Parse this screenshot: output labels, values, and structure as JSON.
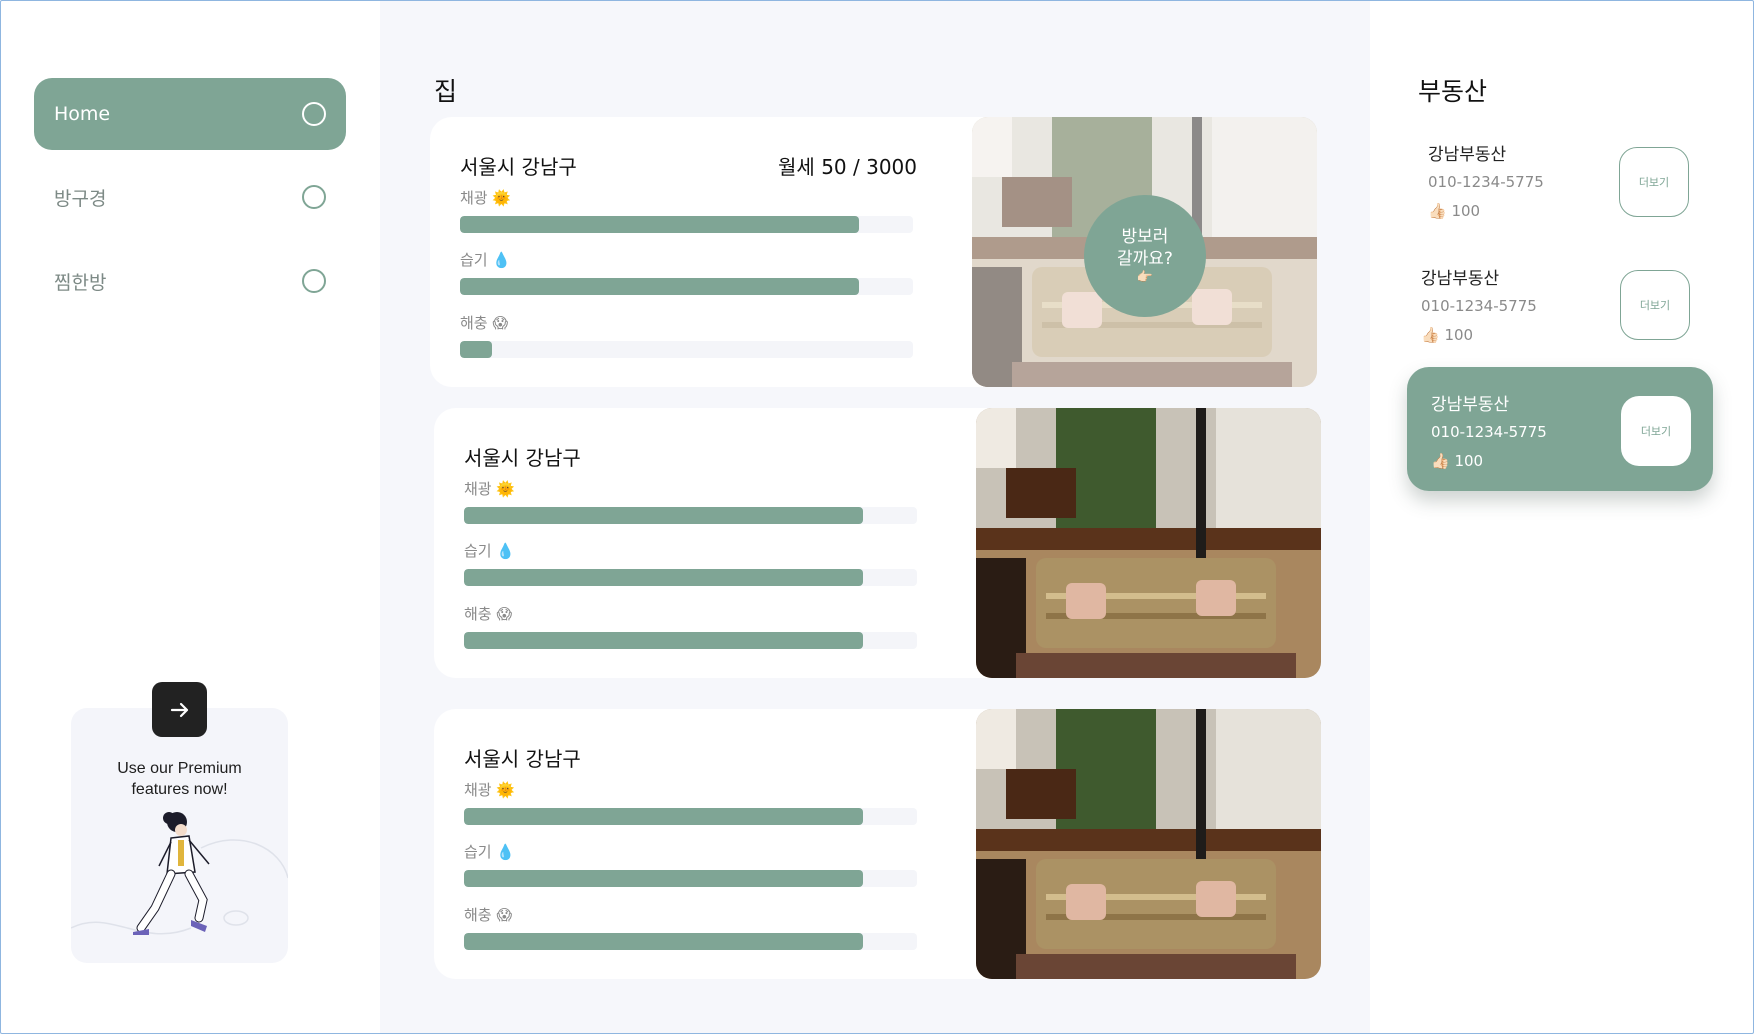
{
  "sidebar": {
    "items": [
      {
        "label": "Home",
        "active": true
      },
      {
        "label": "방구경",
        "active": false
      },
      {
        "label": "찜한방",
        "active": false
      }
    ],
    "promo": {
      "arrow_icon": "arrow-right-icon",
      "text_line1": "Use our Premium",
      "text_line2": "features now!"
    }
  },
  "main": {
    "title": "집",
    "visit_badge": {
      "line1": "방보러",
      "line2": "갈까요?",
      "emoji": "👉🏻"
    },
    "listings": [
      {
        "location": "서울시 강남구",
        "price": "월세 50 / 3000",
        "metrics": [
          {
            "label": "채광 🌞",
            "fraction": 0.88
          },
          {
            "label": "습기 💧",
            "fraction": 0.88
          },
          {
            "label": "해충 😱",
            "fraction": 0.07
          }
        ]
      },
      {
        "location": "서울시 강남구",
        "metrics": [
          {
            "label": "채광 🌞",
            "fraction": 0.88
          },
          {
            "label": "습기 💧",
            "fraction": 0.88
          },
          {
            "label": "해충 😱",
            "fraction": 0.88
          }
        ]
      },
      {
        "location": "서울시 강남구",
        "metrics": [
          {
            "label": "채광 🌞",
            "fraction": 0.88
          },
          {
            "label": "습기 💧",
            "fraction": 0.88
          },
          {
            "label": "해충 😱",
            "fraction": 0.88
          }
        ]
      }
    ]
  },
  "right": {
    "title": "부동산",
    "agents": [
      {
        "name": "강남부동산",
        "phone": "010-1234-5775",
        "likes": "👍🏻 100",
        "more": "더보기",
        "active": false
      },
      {
        "name": "강남부동산",
        "phone": "010-1234-5775",
        "likes": "👍🏻 100",
        "more": "더보기",
        "active": false
      },
      {
        "name": "강남부동산",
        "phone": "010-1234-5775",
        "likes": "👍🏻 100",
        "more": "더보기",
        "active": true
      }
    ]
  },
  "colors": {
    "accent": "#7fa595",
    "background": "#f6f7fb",
    "dark_button": "#222222"
  }
}
